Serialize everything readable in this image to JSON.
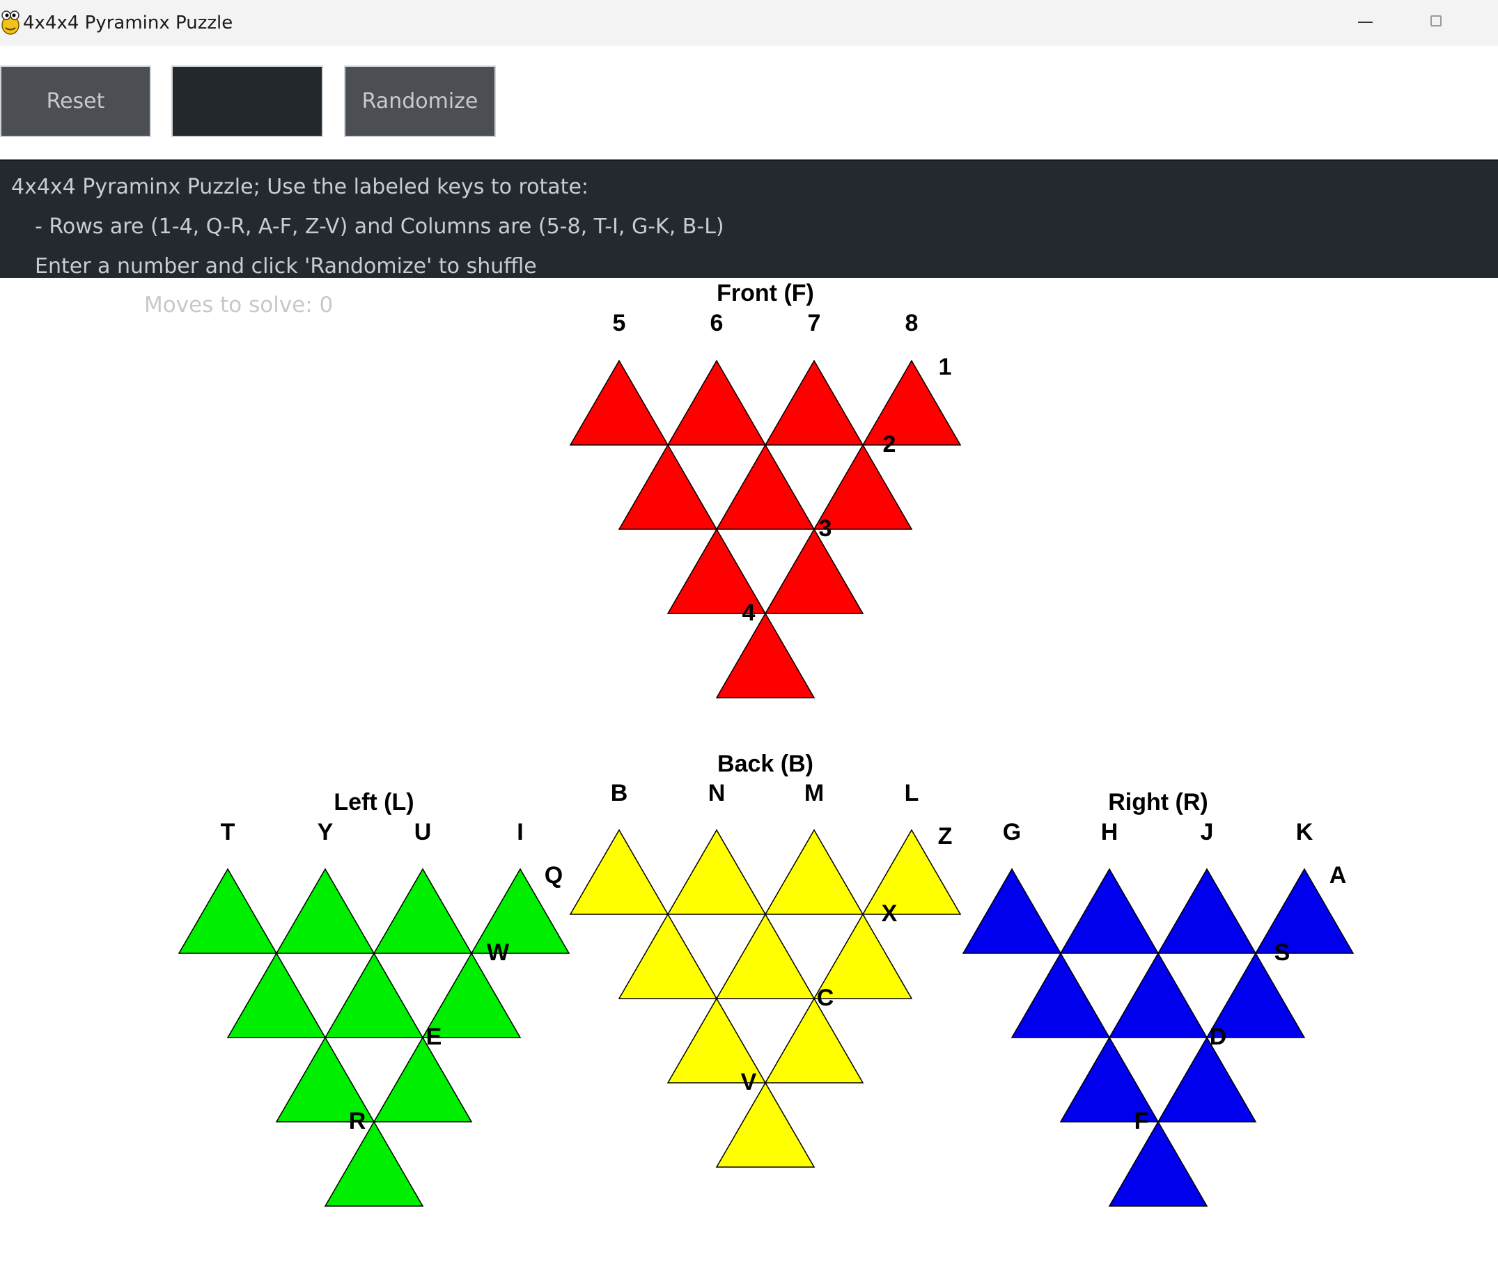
{
  "window": {
    "title": "4x4x4 Pyraminx Puzzle"
  },
  "toolbar": {
    "reset_label": "Reset",
    "number_value": "",
    "randomize_label": "Randomize"
  },
  "instructions": {
    "line1": "4x4x4 Pyraminx Puzzle; Use the labeled keys to rotate:",
    "line2": "- Rows are (1-4, Q-R, A-F, Z-V) and Columns are (5-8, T-I, G-K, B-L)",
    "line3": "Enter a number and click 'Randomize' to shuffle"
  },
  "status": {
    "moves_text": "Moves to solve: 0"
  },
  "faces": [
    {
      "id": "front",
      "title": "Front (F)",
      "color": "#ff0000",
      "column_labels": [
        "5",
        "6",
        "7",
        "8"
      ],
      "row_labels": [
        "1",
        "2",
        "3",
        "4"
      ]
    },
    {
      "id": "back",
      "title": "Back (B)",
      "color": "#ffff00",
      "column_labels": [
        "B",
        "N",
        "M",
        "L"
      ],
      "row_labels": [
        "Z",
        "X",
        "C",
        "V"
      ]
    },
    {
      "id": "left",
      "title": "Left (L)",
      "color": "#00ee00",
      "column_labels": [
        "T",
        "Y",
        "U",
        "I"
      ],
      "row_labels": [
        "Q",
        "W",
        "E",
        "R"
      ]
    },
    {
      "id": "right",
      "title": "Right (R)",
      "color": "#0000ee",
      "column_labels": [
        "G",
        "H",
        "J",
        "K"
      ],
      "row_labels": [
        "A",
        "S",
        "D",
        "F"
      ]
    }
  ]
}
